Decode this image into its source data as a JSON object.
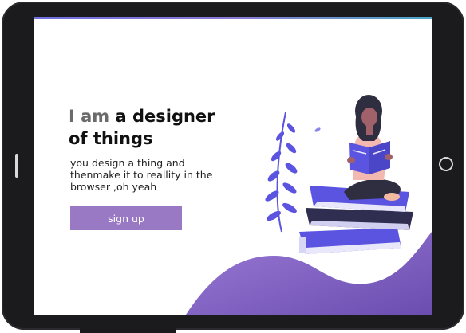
{
  "hero": {
    "title_accent": "I am",
    "title_rest": " a designer",
    "title_line2": "of things",
    "description": "you design a thing and thenmake it to reallity in the browser ,oh yeah",
    "cta_label": "sign up"
  },
  "colors": {
    "accent": "#9a79c4",
    "wave_start": "#8f6fce",
    "wave_end": "#6b4fb3",
    "book_blue": "#5b54e0",
    "book_dark": "#2f2e50"
  },
  "icons": [
    "plant-illustration",
    "reading-woman-illustration",
    "book-stack-illustration"
  ]
}
